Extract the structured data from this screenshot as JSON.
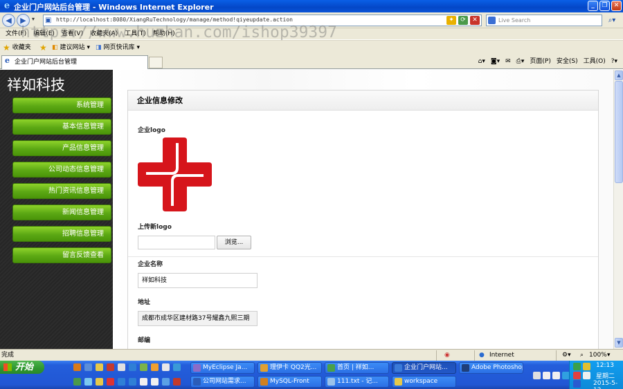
{
  "window": {
    "title": "企业门户网站后台管理 - Windows Internet Explorer"
  },
  "address_bar": {
    "url": "http://localhost:8080/XiangRuTechnology/manage/method!qiyeupdate.action",
    "search_placeholder": "Live Search"
  },
  "menu": {
    "items": [
      "文件(F)",
      "编辑(E)",
      "查看(V)",
      "收藏夹(A)",
      "工具(T)",
      "帮助(H)"
    ]
  },
  "watermark": "https://www.huzhan.com/ishop39397",
  "favorites_bar": {
    "favorites_label": "收藏夹",
    "suggested_sites": "建议网站",
    "web_slice_gallery": "网页快讯库"
  },
  "tab": {
    "label": "企业门户网站后台管理"
  },
  "command_bar": {
    "page": "页面(P)",
    "safety": "安全(S)",
    "tools": "工具(O)"
  },
  "sidebar": {
    "brand": "祥如科技",
    "items": [
      {
        "label": "系统管理"
      },
      {
        "label": "基本信息管理"
      },
      {
        "label": "产品信息管理"
      },
      {
        "label": "公司动态信息管理"
      },
      {
        "label": "热门资讯信息管理"
      },
      {
        "label": "新闻信息管理"
      },
      {
        "label": "招聘信息管理"
      },
      {
        "label": "留言反馈查看"
      }
    ]
  },
  "form": {
    "title": "企业信息修改",
    "logo_label": "企业logo",
    "upload_label": "上传新logo",
    "browse_button": "浏览...",
    "name_label": "企业名称",
    "name_value": "祥如科技",
    "address_label": "地址",
    "address_value": "成都市成华区建材路37号耀鑫九熙三期",
    "postcode_label": "邮编",
    "logo_colors": {
      "primary": "#d6151b",
      "accent": "#ffffff"
    }
  },
  "status_bar": {
    "text": "完成",
    "zone": "Internet",
    "zoom": "100%"
  },
  "taskbar": {
    "start_label": "开始",
    "buttons": [
      {
        "label": "MyEclipse Ja..."
      },
      {
        "label": "理伊卡 QQ2光..."
      },
      {
        "label": "首页 | 祥如..."
      },
      {
        "label": "企业门户网站..."
      },
      {
        "label": "Adobe Photoshop"
      },
      {
        "label": "公司网站需求..."
      },
      {
        "label": "MySQL-Front"
      },
      {
        "label": "111.txt - 记..."
      },
      {
        "label": "workspace"
      }
    ],
    "clock": "12:13",
    "weekday": "星期二",
    "date": "2015-5-12"
  }
}
